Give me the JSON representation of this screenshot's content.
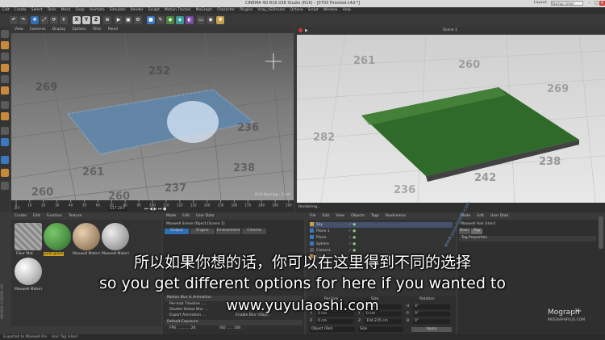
{
  "window": {
    "title": "CINEMA 4D R16.038 Studio (R16) - [0703 Finished.c4d *]",
    "layout_label": "Layout:",
    "layout_value": "Startup (User)",
    "min": "–",
    "max": "□",
    "close": "✕"
  },
  "menubar": [
    "Edit",
    "Create",
    "Select",
    "Tools",
    "Mesh",
    "Snap",
    "Animate",
    "Simulate",
    "Render",
    "Sculpt",
    "Motion Tracker",
    "MoGraph",
    "Character",
    "Plugins",
    "Vray_sSStream",
    "Octane",
    "Script",
    "Window",
    "Help"
  ],
  "toolbar": {
    "axis_buttons": [
      "X",
      "Y",
      "Z"
    ],
    "icons": [
      "undo-icon",
      "redo-icon",
      "move-icon",
      "scale-icon",
      "rotate-icon",
      "live-select-icon",
      "coordinate-icon",
      "render-view-icon",
      "render-pv-icon",
      "render-settings-icon",
      "cube-icon",
      "pen-icon",
      "subdivision-icon",
      "array-icon",
      "deformer-icon",
      "floor-icon",
      "camera-icon",
      "light-icon"
    ]
  },
  "viewport_left": {
    "menu": [
      "View",
      "Cameras",
      "Display",
      "Options",
      "Filter",
      "Panel"
    ],
    "grid_spacing": "Grid Spacing : 1 cm",
    "floor_numbers": [
      "261",
      "238",
      "237",
      "260",
      "260",
      "269",
      "236",
      "252"
    ]
  },
  "viewport_right": {
    "menu_icons": [
      "play-icon",
      "record-icon"
    ],
    "title": "Scene 1",
    "status": "Rendering...",
    "floor_numbers": [
      "238",
      "242",
      "261",
      "260",
      "282",
      "269",
      "236"
    ]
  },
  "timeline": {
    "ticks": [
      "0",
      "10",
      "20",
      "30",
      "40",
      "50",
      "60",
      "70",
      "80",
      "90",
      "100",
      "110",
      "120",
      "130",
      "140",
      "150",
      "160",
      "170",
      "180",
      "190",
      "200"
    ],
    "frame_start": "0 F",
    "frame_current": "217.20 F"
  },
  "materials": {
    "menu": [
      "Create",
      "Edit",
      "Function",
      "Texture"
    ],
    "items": [
      {
        "label": "Fiber Mat",
        "color": "#9a9a9a"
      },
      {
        "label": "junk grass",
        "color": "#3f8a3f"
      },
      {
        "label": "Maxwell Materi",
        "color": "#b59a78"
      },
      {
        "label": "Maxwell Materi",
        "color": "#b8b8b8"
      },
      {
        "label": "Maxwell Materi",
        "color": "#d0d0d0"
      }
    ]
  },
  "attributes": {
    "menu": [
      "Mode",
      "Edit",
      "User Data"
    ],
    "object_title": "Maxwell Scene Object [Scene 1]",
    "tabs": [
      "Output",
      "Engine",
      "Environment",
      "Cinema"
    ],
    "sections": [
      "Motion Blur & Animation",
      "Default Exposure"
    ],
    "rows": [
      "Per-mat Timeline .....",
      "Shutter Below Blur ...",
      "Export Animation ...",
      "Enable Blur (Objs) .",
      "FPS ........... 24",
      "ISO ..... 100"
    ]
  },
  "objects": {
    "menu": [
      "File",
      "Edit",
      "View",
      "Objects",
      "Tags",
      "Bookmarks"
    ],
    "items": [
      "Sky",
      "Plane 1",
      "Plane",
      "Sphere",
      "Camera",
      "Light"
    ],
    "coords_headers": [
      "Position",
      "Size",
      "Rotation"
    ],
    "coords_rows": [
      [
        "X",
        "0 cm",
        "X",
        "0 cm",
        "H",
        "0°"
      ],
      [
        "Y",
        "0 cm",
        "Y",
        "0 cm",
        "P",
        "0°"
      ],
      [
        "Z",
        "0 cm",
        "Z",
        "104.235 cm",
        "B",
        "0°"
      ]
    ],
    "mode_select": "Object (Rel)",
    "size_select": "Size",
    "apply": "Apply"
  },
  "tag": {
    "menu": [
      "Mode",
      "Edit",
      "User Data"
    ],
    "title": "Maxwell Hair [Hair]",
    "tabs": [
      "Basic",
      "Tag"
    ],
    "section": "Tag Properties",
    "watermark_brand": "Mograph",
    "watermark_site": "MOGRAPHPLUS.COM",
    "watermark_vertical": "www.yuyulaoshi.com"
  },
  "subtitles": {
    "chinese": "所以如果你想的话，你可以在这里得到不同的选择",
    "english": "so you get different options for here if you wanted to",
    "site": "www.yuyulaoshi.com"
  },
  "status": {
    "left": "Exported to Maxwell Pro",
    "right": "Hair Tag [Hair]",
    "vertical_brand": "MAXON CINEMA 4D"
  }
}
